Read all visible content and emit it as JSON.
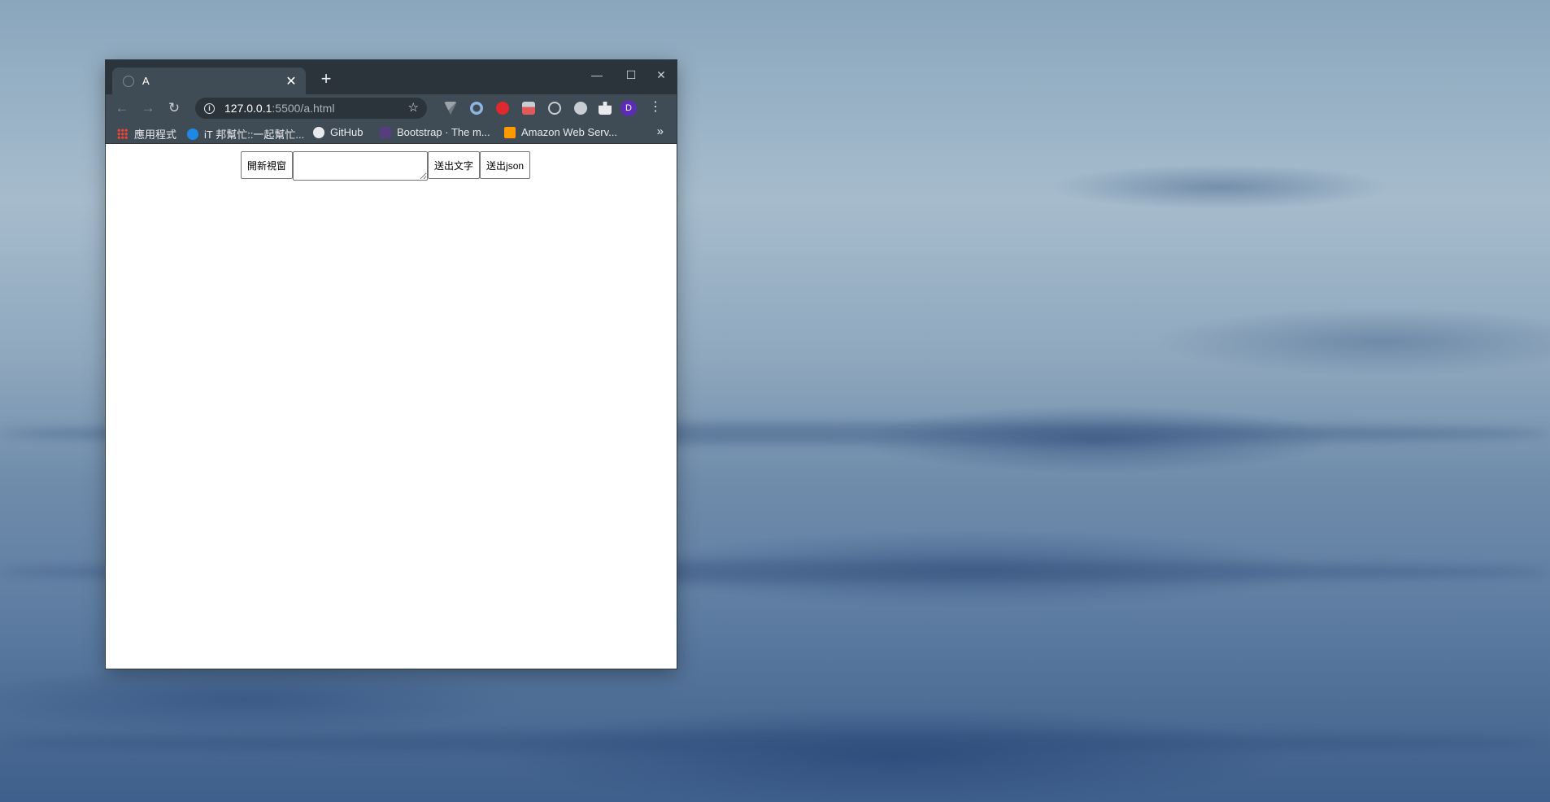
{
  "browser": {
    "tab": {
      "title": "A",
      "close_label": "✕"
    },
    "new_tab_label": "+",
    "window_controls": {
      "minimize": "—",
      "maximize": "☐",
      "close": "✕"
    },
    "nav": {
      "back": "←",
      "forward": "→",
      "reload": "↻"
    },
    "address": {
      "host": "127.0.0.1",
      "path": ":5500/a.html",
      "info_icon": "i",
      "star": "☆"
    },
    "avatar_letter": "D",
    "menu": "⋮",
    "bookmarks": [
      {
        "label": "應用程式",
        "icon": "apps-grid-icon"
      },
      {
        "label": "iT 邦幫忙::一起幫忙...",
        "icon": "ithelp-icon"
      },
      {
        "label": "GitHub",
        "icon": "github-icon"
      },
      {
        "label": "Bootstrap · The m...",
        "icon": "bootstrap-icon"
      },
      {
        "label": "Amazon Web Serv...",
        "icon": "aws-icon"
      }
    ],
    "more_bookmarks": "»"
  },
  "page": {
    "open_window_button": "開新視窗",
    "message_input": {
      "value": "",
      "placeholder": ""
    },
    "send_text_button": "送出文字",
    "send_json_button": "送出json"
  },
  "colors": {
    "titlebar": "#2b343b",
    "toolbar": "#404c55",
    "avatar": "#5b2cb4"
  }
}
